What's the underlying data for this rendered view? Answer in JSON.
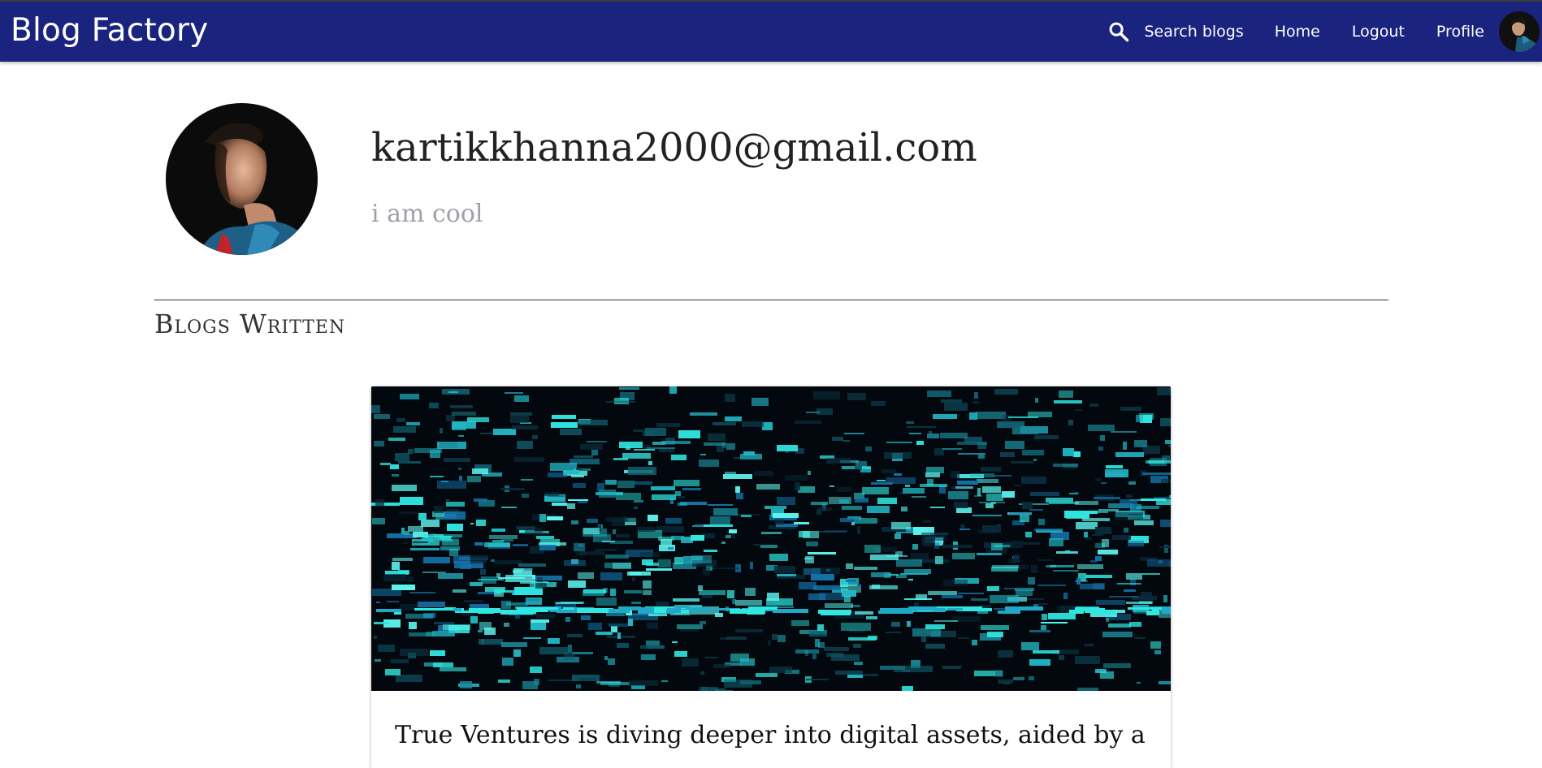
{
  "app": {
    "brand": "Blog Factory"
  },
  "nav": {
    "search_label": "Search blogs",
    "home_label": "Home",
    "logout_label": "Logout",
    "profile_label": "Profile"
  },
  "profile": {
    "email": "kartikkhanna2000@gmail.com",
    "bio": "i am cool"
  },
  "section": {
    "title": "Blogs Written"
  },
  "blogs": [
    {
      "title": "True Ventures is diving deeper into digital assets, aided by a"
    }
  ],
  "colors": {
    "navbar": "#1a237e",
    "bio_text": "#a0a0a8",
    "accent_cyan": "#2fe6e0"
  },
  "icons": {
    "search": "search-icon",
    "avatar": "avatar"
  }
}
